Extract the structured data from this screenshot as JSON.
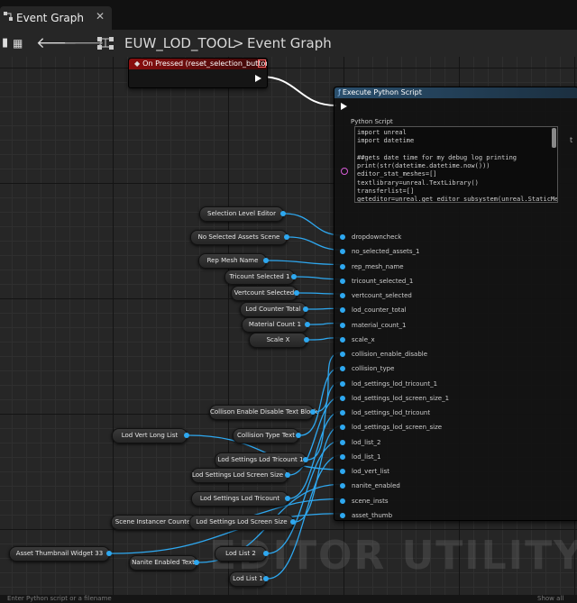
{
  "tab": {
    "title": "Event Graph",
    "close": "✕"
  },
  "toolbar": {
    "blueprint_name": "EUW_LOD_TOOL",
    "separator": ">",
    "graph_name": "Event Graph"
  },
  "event_node": {
    "title": "On Pressed (reset_selection_button)"
  },
  "python_node": {
    "title": "Execute Python Script",
    "script_label": "Python Script",
    "code": "import unreal\nimport datetime\n\n##gets date time for my debug log printing\nprint(str(datetime.datetime.now()))\neditor_stat_meshes=[]\ntextlibrary=unreal.TextLibrary()\ntransferlist=[]\ngeteditor=unreal.get_editor_subsystem(unreal.StaticMeshEditorSu",
    "pins": [
      "dropdowncheck",
      "no_selected_assets_1",
      "rep_mesh_name",
      "tricount_selected_1",
      "vertcount_selected",
      "lod_counter_total",
      "material_count_1",
      "scale_x",
      "collision_enable_disable",
      "collision_type",
      "lod_settings_lod_tricount_1",
      "lod_settings_lod_screen_size_1",
      "lod_settings_lod_tricount",
      "lod_settings_lod_screen_size",
      "lod_list_2",
      "lod_list_1",
      "lod_vert_list",
      "nanite_enabled",
      "scene_insts",
      "asset_thumb"
    ]
  },
  "variables": [
    "Selection Level Editor",
    "No Selected Assets Scene",
    "Rep Mesh Name",
    "Tricount Selected 1",
    "Vertcount Selected",
    "Lod Counter Total",
    "Material Count 1",
    "Scale X",
    "Collison Enable Disable Text Block",
    "Collision Type Text",
    "Lod Vert Long List",
    "Lod Settings Lod Tricount 1",
    "Lod Settings Lod Screen Size 1",
    "Lod Settings Lod Tricount",
    "Scene Instancer Counter",
    "Lod Settings Lod Screen Size",
    "Asset Thumbnail Widget 33",
    "Lod List 2",
    "Nanite Enabled Text",
    "Lod List 1"
  ],
  "watermark": "EDITOR UTILITY WI",
  "right_edge": "t",
  "status": {
    "text": "Enter Python script or a filename",
    "right": "Show all"
  },
  "colors": {
    "exec_wire": "#ffffff",
    "data_wire": "#2ea8f0",
    "event_header": "#8a0f0f",
    "python_header": "#2a4f6d"
  }
}
